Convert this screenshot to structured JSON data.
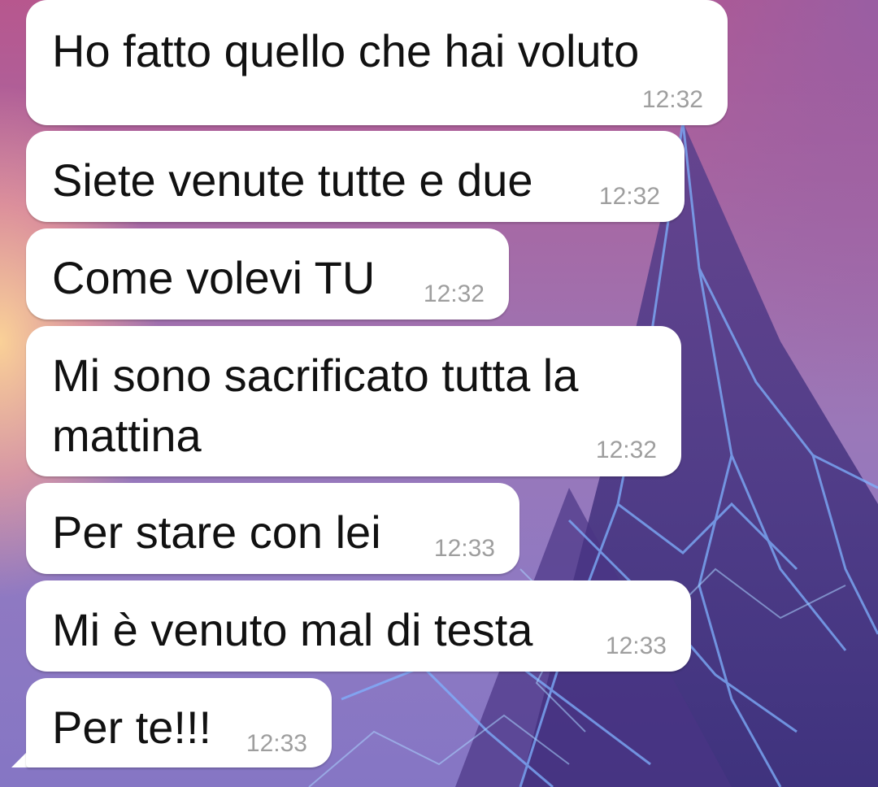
{
  "messages": [
    {
      "text": "Ho fatto quello che hai voluto",
      "time": "12:32"
    },
    {
      "text": "Siete venute tutte e due",
      "time": "12:32"
    },
    {
      "text": "Come volevi TU",
      "time": "12:32"
    },
    {
      "text_line1": "Mi sono sacrificato tutta la",
      "text_line2": "mattina",
      "time": "12:32"
    },
    {
      "text": "Per stare con lei",
      "time": "12:33"
    },
    {
      "text": "Mi è venuto mal di testa",
      "time": "12:33"
    },
    {
      "text": "Per te!!!",
      "time": "12:33"
    }
  ],
  "colors": {
    "bubble": "#ffffff",
    "text": "#111111",
    "timestamp": "#9e9e9e"
  }
}
